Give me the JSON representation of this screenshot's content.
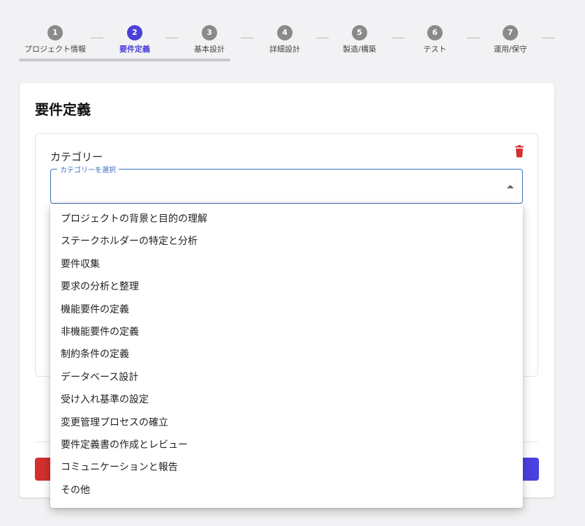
{
  "stepper": {
    "steps": [
      {
        "number": "1",
        "label": "プロジェクト情報",
        "active": false
      },
      {
        "number": "2",
        "label": "要件定義",
        "active": true
      },
      {
        "number": "3",
        "label": "基本設計",
        "active": false
      },
      {
        "number": "4",
        "label": "詳細設計",
        "active": false
      },
      {
        "number": "5",
        "label": "製造/構築",
        "active": false
      },
      {
        "number": "6",
        "label": "テスト",
        "active": false
      },
      {
        "number": "7",
        "label": "運用/保守",
        "active": false
      }
    ],
    "active_color": "#4b40d8",
    "inactive_color": "#8a8a8a"
  },
  "card": {
    "title": "要件定義"
  },
  "category": {
    "label": "カテゴリー",
    "select_legend": "カテゴリーを選択",
    "selected_value": "",
    "delete_icon": "trash-icon",
    "delete_color": "#d32f2f"
  },
  "dropdown": {
    "options": [
      "プロジェクトの背景と目的の理解",
      "ステークホルダーの特定と分析",
      "要件収集",
      "要求の分析と整理",
      "機能要件の定義",
      "非機能要件の定義",
      "制約条件の定義",
      "データベース設計",
      "受け入れ基準の設定",
      "変更管理プロセスの確立",
      "要件定義書の作成とレビュー",
      "コミュニケーションと報告",
      "その他"
    ]
  },
  "footer": {
    "primary_color": "#4b40e0",
    "danger_color": "#d32f2f"
  }
}
